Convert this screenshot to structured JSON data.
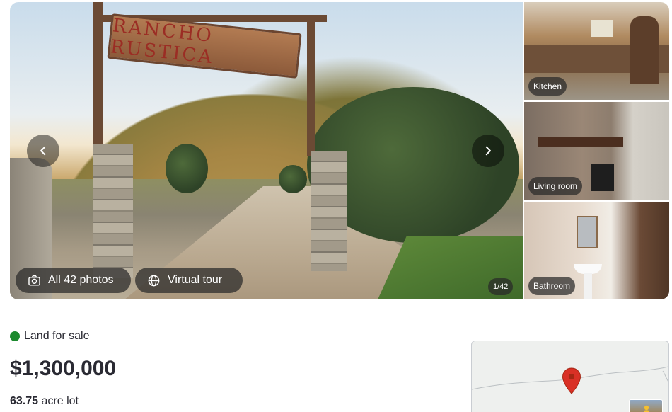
{
  "gallery": {
    "hero_sign_text": "RANCHO RUSTICA",
    "photos_button_label": "All 42 photos",
    "tour_button_label": "Virtual tour",
    "counter": "1/42",
    "thumbnails": [
      {
        "label": "Kitchen"
      },
      {
        "label": "Living room"
      },
      {
        "label": "Bathroom"
      }
    ]
  },
  "listing": {
    "status": "Land for sale",
    "status_color": "#1c8a2e",
    "price": "$1,300,000",
    "lot_value": "63.75",
    "lot_unit": "acre lot"
  },
  "map": {
    "pin_color": "#d93025"
  },
  "icons": [
    "chevron-left-icon",
    "chevron-right-icon",
    "camera-icon",
    "globe-icon",
    "map-pin-icon",
    "street-view-icon"
  ]
}
